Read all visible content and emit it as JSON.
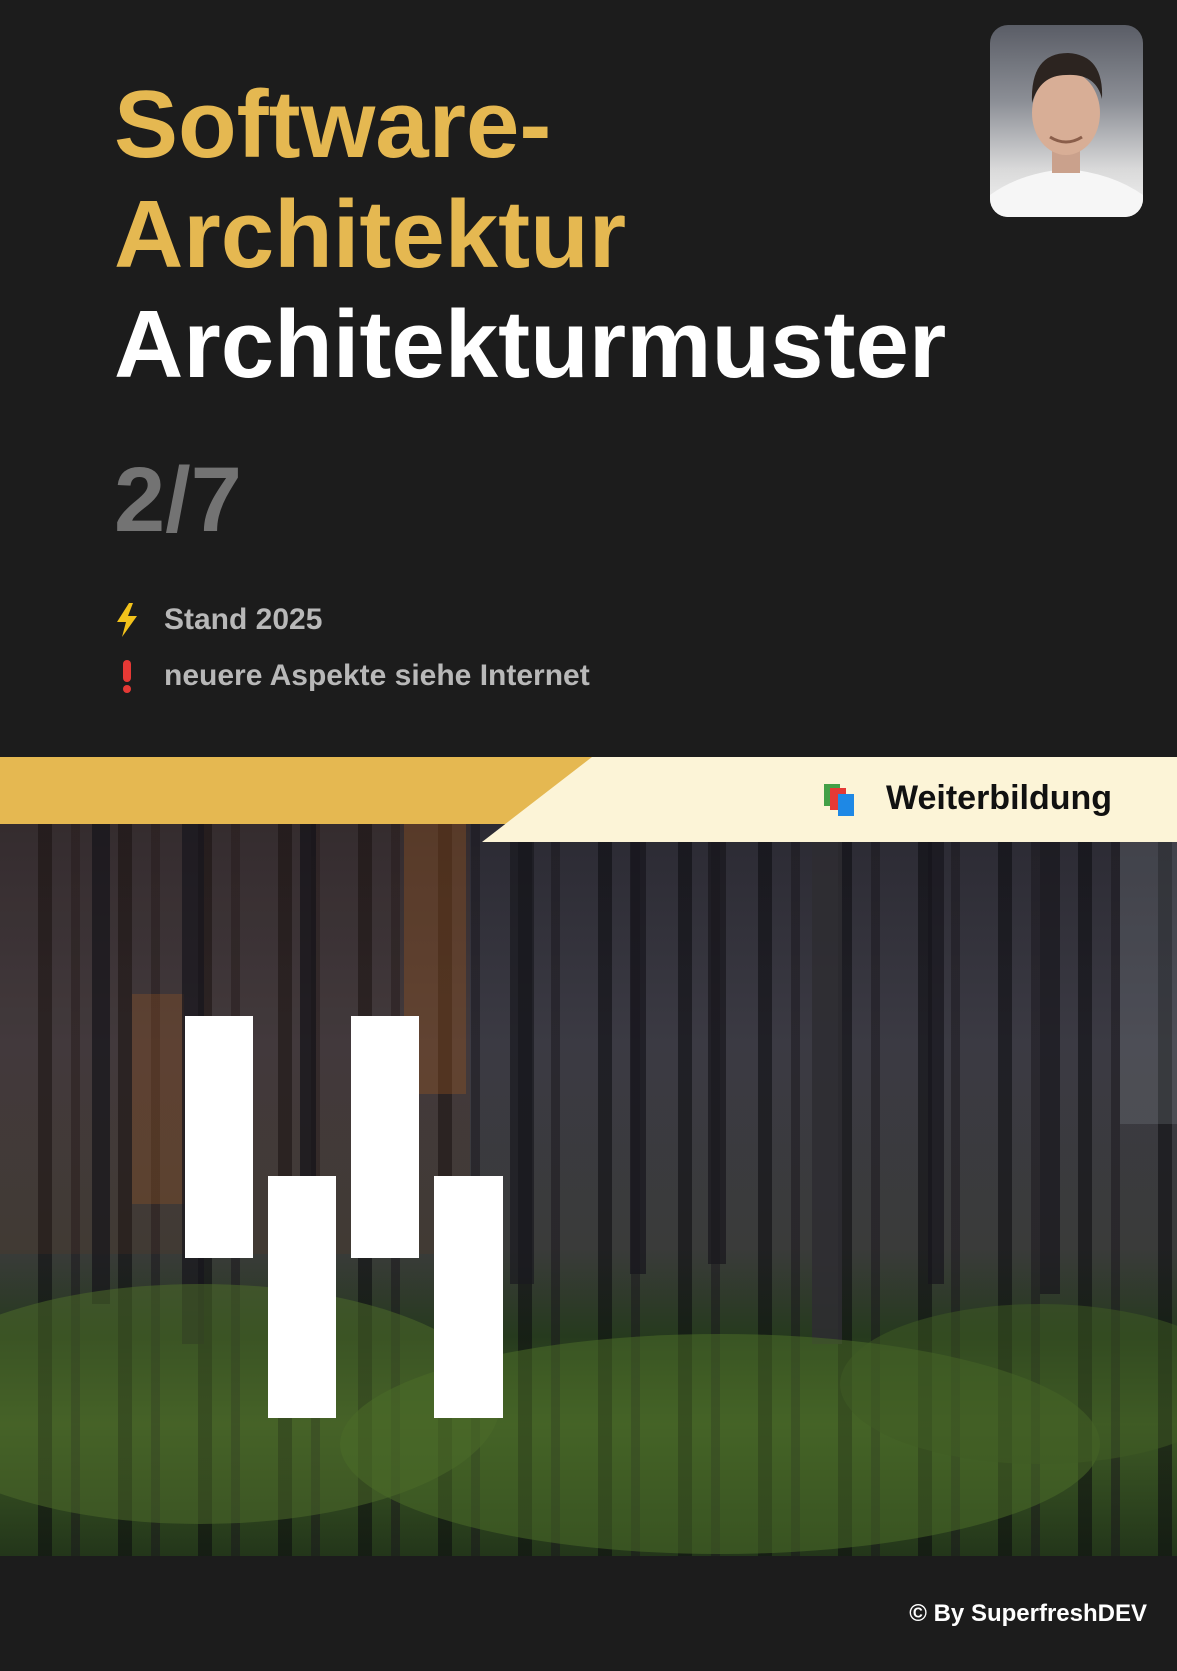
{
  "title": {
    "line1": "Software-",
    "line2": "Architektur",
    "line3": "Architekturmuster"
  },
  "page_counter": "2/7",
  "info": [
    {
      "icon": "lightning-icon",
      "text": "Stand 2025"
    },
    {
      "icon": "exclamation-icon",
      "text": "neuere Aspekte siehe Internet"
    }
  ],
  "banner": {
    "label": "Weiterbildung",
    "icon": "books-icon"
  },
  "footer": {
    "text": "© By SuperfreshDEV"
  },
  "colors": {
    "background": "#1c1c1c",
    "accent_gold": "#e5b851",
    "banner_cream": "#fcf4d7",
    "counter_gray": "#737373",
    "info_text": "#b8b8b8"
  }
}
